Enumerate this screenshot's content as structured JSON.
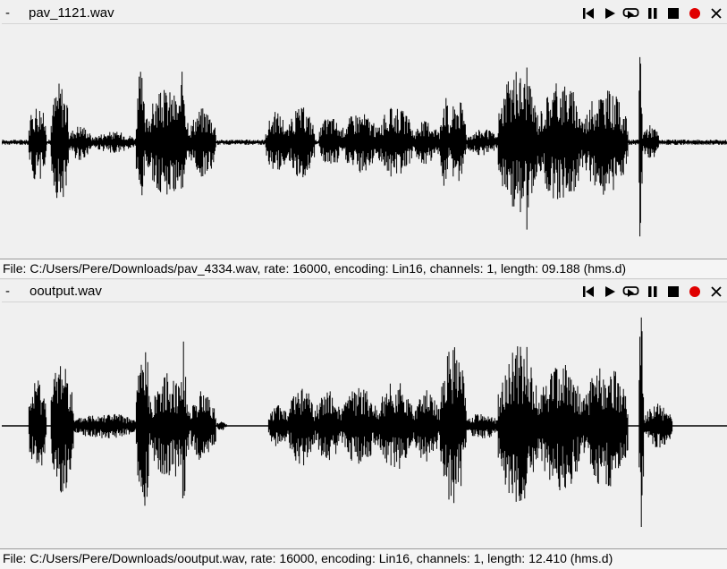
{
  "colors": {
    "waveform": "#000000",
    "record": "#e00000",
    "background": "#f0f0f0",
    "status_background": "#f5f5f5"
  },
  "icons": [
    "skip-to-start-icon",
    "play-icon",
    "loop-play-icon",
    "pause-icon",
    "stop-icon",
    "record-icon",
    "close-icon"
  ],
  "panels": [
    {
      "menu_label": "-",
      "title": "pav_1121.wav",
      "status": "File: C:/Users/Pere/Downloads/pav_4334.wav, rate: 16000, encoding: Lin16, channels: 1, length: 09.188 (hms.d)"
    },
    {
      "menu_label": "-",
      "title": "ooutput.wav",
      "status": "File: C:/Users/Pere/Downloads/ooutput.wav, rate: 16000, encoding: Lin16, channels: 1, length: 12.410 (hms.d)"
    }
  ]
}
